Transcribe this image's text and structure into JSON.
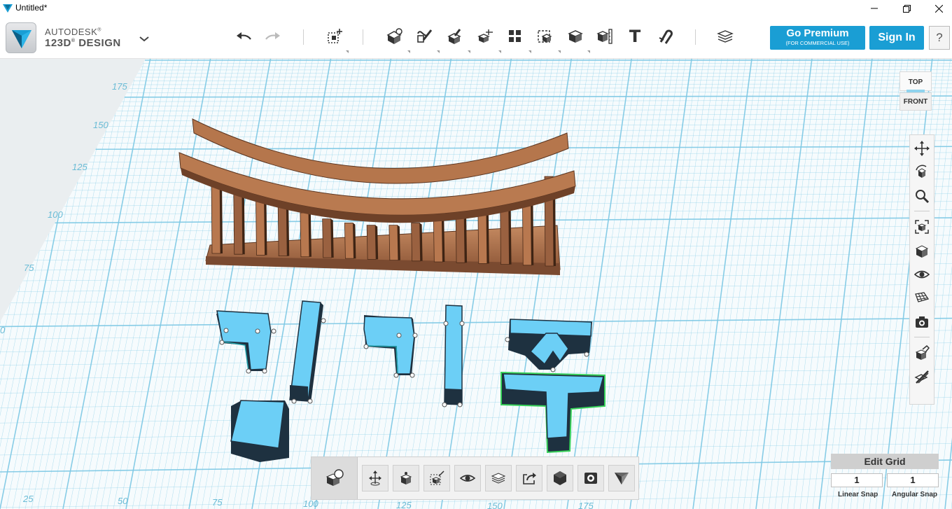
{
  "window": {
    "title": "Untitled*"
  },
  "brand": {
    "line1": "AUTODESK",
    "reg1": "®",
    "line2": "123D",
    "reg2": "®",
    "line2b": " DESIGN"
  },
  "toolbar": {
    "premium_label": "Go Premium",
    "premium_sub": "(FOR COMMERCIAL USE)",
    "signin_label": "Sign In",
    "help_label": "?",
    "text_tool_label": "T"
  },
  "viewcube": {
    "top_label": "TOP",
    "front_label": "FRONT"
  },
  "grid_numbers": {
    "left": [
      "175",
      "150",
      "125",
      "100",
      "75",
      "0"
    ],
    "bottom": [
      "25",
      "50",
      "75",
      "100",
      "125",
      "150",
      "175"
    ]
  },
  "edit_grid": {
    "title": "Edit Grid",
    "linear_snap_value": "1",
    "angular_snap_value": "1",
    "linear_snap_label": "Linear Snap",
    "angular_snap_label": "Angular Snap"
  },
  "colors": {
    "accent": "#1a9ed4",
    "grid_line": "#7cc8e4",
    "object_blue": "#6ccff6",
    "object_dark": "#243846",
    "wood": "#b97a54",
    "selection": "#38d25a"
  },
  "icons": {
    "toolbar": [
      "undo-icon",
      "redo-icon",
      "primitives-icon",
      "sketch-icon",
      "construct-icon",
      "modify-icon",
      "pattern-icon",
      "group-icon",
      "combine-icon",
      "measure-icon",
      "text-icon",
      "snap-icon",
      "materials-icon"
    ],
    "nav": [
      "pan-icon",
      "orbit-icon",
      "zoom-icon",
      "fit-icon",
      "view-icon",
      "visibility-icon",
      "grid-icon",
      "camera-icon",
      "material-icon",
      "hide-icon"
    ],
    "bottom": [
      "smart-object-icon",
      "move-icon",
      "scale-icon",
      "smart-scale-icon",
      "show-icon",
      "layers-icon",
      "export-icon",
      "solid-icon",
      "render-icon",
      "printer-icon"
    ]
  }
}
